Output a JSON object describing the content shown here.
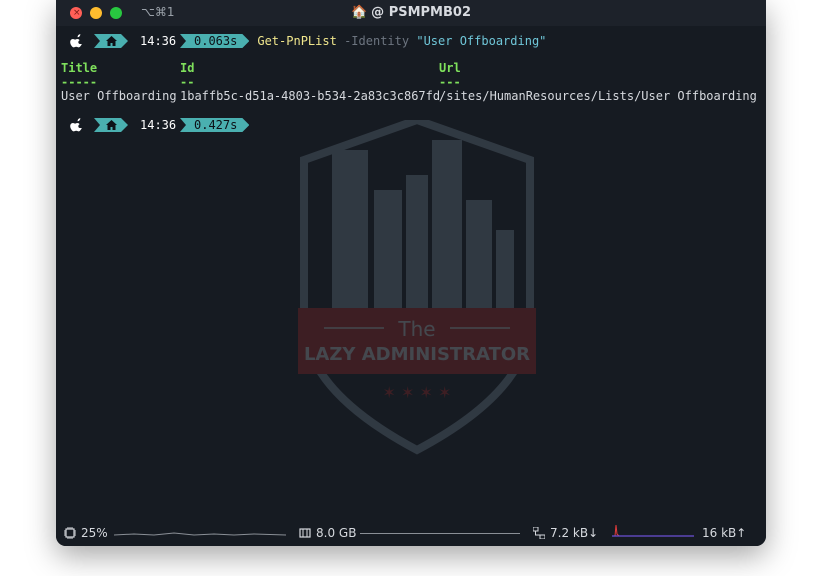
{
  "window": {
    "shortcut": "⌥⌘1",
    "title": "@ PSMPMB02"
  },
  "prompt1": {
    "time": "14:36",
    "duration": "0.063s",
    "command": "Get-PnPList",
    "param": "-Identity",
    "value": "\"User Offboarding\""
  },
  "output": {
    "headers": [
      "Title",
      "Id",
      "Url"
    ],
    "separators": [
      "-----",
      "--",
      "---"
    ],
    "row": [
      "User Offboarding",
      "1baffb5c-d51a-4803-b534-2a83c3c867fd",
      "/sites/HumanResources/Lists/User Offboarding"
    ]
  },
  "prompt2": {
    "time": "14:36",
    "duration": "0.427s"
  },
  "watermark": {
    "line1": "The",
    "line2": "LAZY ADMINISTRATOR"
  },
  "status": {
    "cpu": "25%",
    "memory": "8.0 GB",
    "net_down": "7.2 kB↓",
    "net_up": "16 kB↑"
  },
  "colors": {
    "accent": "#4ab0b0",
    "header_green": "#7fe05c",
    "command_yellow": "#f0e68c",
    "string_cyan": "#6fc6d8"
  }
}
